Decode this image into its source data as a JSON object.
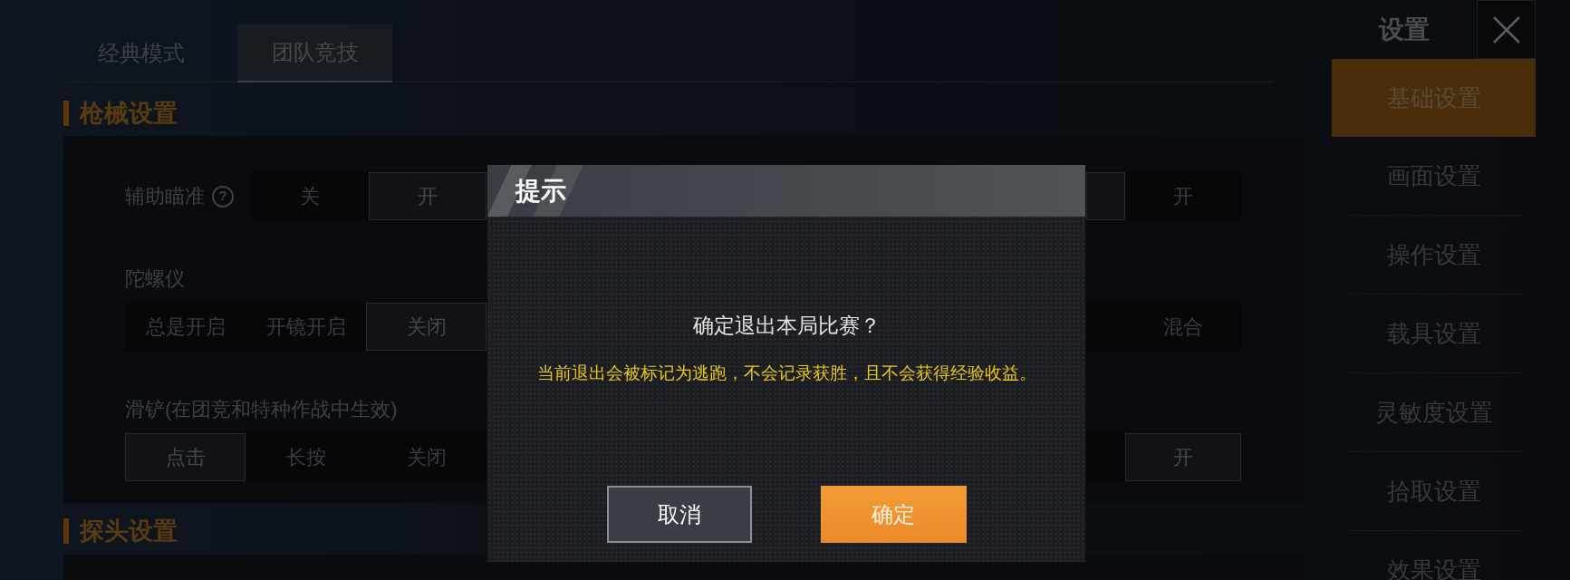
{
  "mode_tabs": [
    {
      "label": "经典模式",
      "selected": false
    },
    {
      "label": "团队竞技",
      "selected": true
    }
  ],
  "sections": [
    {
      "title": "枪械设置",
      "settings": [
        {
          "kind": "inline",
          "label": "辅助瞄准",
          "hint": "?",
          "options": [
            {
              "label": "关",
              "selected": false
            },
            {
              "label": "开",
              "selected": true
            }
          ],
          "right_options": [
            {
              "selected": true
            },
            {
              "label": "开",
              "selected": false
            }
          ]
        },
        {
          "kind": "stacked",
          "label": "陀螺仪",
          "options": [
            {
              "label": "总是开启",
              "selected": false
            },
            {
              "label": "开镜开启",
              "selected": false
            },
            {
              "label": "关闭",
              "selected": true
            }
          ],
          "right_options": [
            {
              "selected": false
            },
            {
              "label": "混合",
              "selected": false
            }
          ]
        },
        {
          "kind": "stacked",
          "label": "滑铲(在团竞和特种作战中生效)",
          "options": [
            {
              "label": "点击",
              "selected": true
            },
            {
              "label": "长按",
              "selected": false
            },
            {
              "label": "关闭",
              "selected": false
            }
          ],
          "right_options": [
            {
              "selected": false
            },
            {
              "label": "开",
              "selected": true
            }
          ]
        }
      ]
    },
    {
      "title": "探头设置"
    }
  ],
  "sidebar": {
    "title": "设置",
    "items": [
      {
        "label": "基础设置",
        "selected": true
      },
      {
        "label": "画面设置",
        "selected": false
      },
      {
        "label": "操作设置",
        "selected": false
      },
      {
        "label": "载具设置",
        "selected": false
      },
      {
        "label": "灵敏度设置",
        "selected": false
      },
      {
        "label": "拾取设置",
        "selected": false
      },
      {
        "label": "效果设置",
        "selected": false
      }
    ]
  },
  "dialog": {
    "title": "提示",
    "message": "确定退出本局比赛？",
    "warning": "当前退出会被标记为逃跑，不会记录获胜，且不会获得经验收益。",
    "buttons": [
      {
        "label": "取消",
        "kind": "secondary"
      },
      {
        "label": "确定",
        "kind": "primary"
      }
    ]
  }
}
